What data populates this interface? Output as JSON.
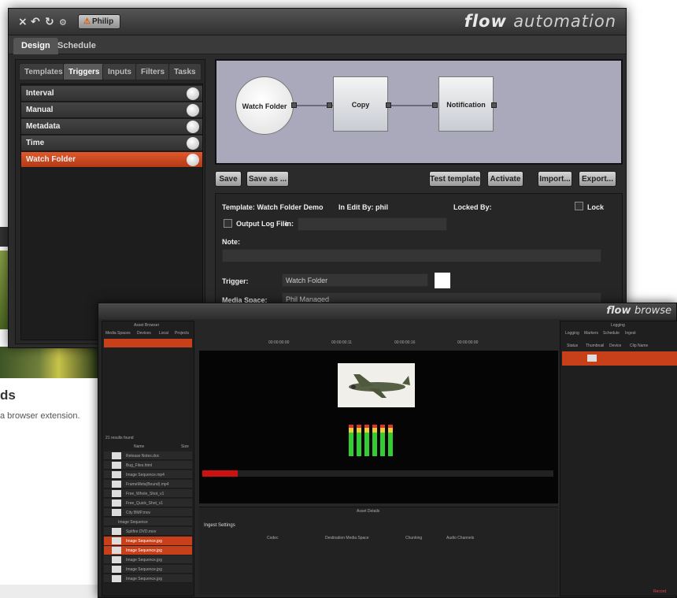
{
  "background_page": {
    "heading": "ds",
    "text": "a browser extension."
  },
  "main_window": {
    "brand_bold": "flow",
    "brand_rest": "automation",
    "user": "Philip",
    "tabs": [
      "Design",
      "Schedule"
    ],
    "subtabs": [
      "Templates",
      "Triggers",
      "Inputs",
      "Filters",
      "Tasks"
    ],
    "triggers": [
      "Interval",
      "Manual",
      "Metadata",
      "Time",
      "Watch Folder"
    ],
    "selected_trigger": "Watch Folder",
    "workflow": {
      "nodes": [
        "Watch Folder",
        "Copy",
        "Notification"
      ]
    },
    "buttons": {
      "save": "Save",
      "save_as": "Save as ...",
      "test": "Test template",
      "activate": "Activate",
      "import": "Import...",
      "export": "Export..."
    },
    "form": {
      "template_label": "Template: Watch Folder Demo",
      "edit_by_label": "In Edit By: phil",
      "locked_by_label": "Locked By:",
      "lock_label": "Lock",
      "output_log_label": "Output Log File",
      "in_label": "in:",
      "note_label": "Note:",
      "trigger_label": "Trigger:",
      "trigger_value": "Watch Folder",
      "media_space_label": "Media Space:",
      "media_space_value": "Phil Managed"
    }
  },
  "second_window": {
    "brand_bold": "flow",
    "brand_rest": "browse",
    "asset_browser_title": "Asset Browser",
    "asset_tabs": [
      "Media Spaces",
      "Devices",
      "Local",
      "Projects"
    ],
    "results": "21 results found",
    "col_name": "Name",
    "col_size": "Size",
    "logging_title": "Logging",
    "log_tabs": [
      "Logging",
      "Markers",
      "Schedule",
      "Ingest"
    ],
    "log_cols": [
      "Status",
      "Thumbnail",
      "Device",
      "Clip Name"
    ],
    "timecodes": [
      "00:00:00:00",
      "00:00:00:11",
      "00:00:00:16",
      "00:00:00:00"
    ],
    "ingest_settings": "Ingest Settings",
    "asset_details": "Asset Details",
    "codec": "Codec",
    "dest_media_space": "Destination Media Space",
    "chunking": "Chunking",
    "audio_channels": "Audio Channels",
    "record": "Record",
    "files": [
      "Release Notes.doc",
      "Bug_Files.html",
      "Image Sequence.mp4",
      "FrameMeta(Bound).mp4",
      "Free_Whole_Shot_v1",
      "Free_Quick_Shot_v1",
      "City BMP.mov",
      "Image Sequence",
      "Spitfire DVD.mov",
      "Image Sequence.jpg",
      "Image Sequence.jpg",
      "Image Sequence.jpg",
      "Image Sequence.jpg",
      "Image Sequence.jpg"
    ]
  }
}
